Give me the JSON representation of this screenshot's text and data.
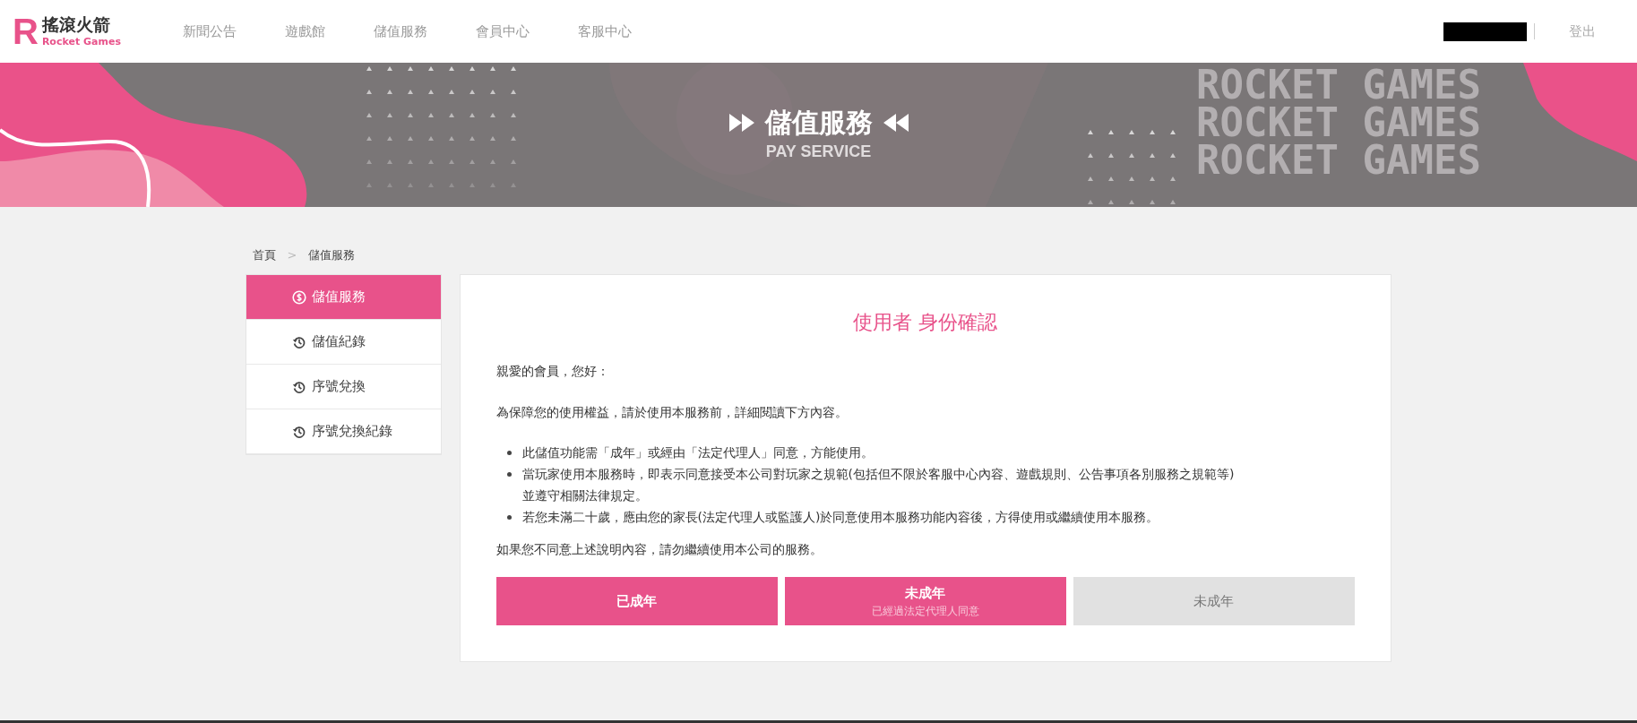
{
  "logo": {
    "mark": "R",
    "title": "搖滾火箭",
    "subtitle": "Rocket Games"
  },
  "nav": [
    {
      "label": "新聞公告",
      "selected": false
    },
    {
      "label": "遊戲館",
      "selected": false
    },
    {
      "label": "儲值服務",
      "selected": false
    },
    {
      "label": "會員中心",
      "selected": false
    },
    {
      "label": "客服中心",
      "selected": false
    }
  ],
  "logout": "登出",
  "banner": {
    "title": "儲值服務",
    "subtitle": "PAY SERVICE",
    "watermark": [
      "ROCKET GAMES",
      "ROCKET GAMES",
      "ROCKET GAMES"
    ]
  },
  "breadcrumb": [
    {
      "label": "首頁"
    },
    {
      "label": ">"
    },
    {
      "label": "儲值服務"
    }
  ],
  "sidebar": {
    "items": [
      {
        "label": "儲值服務",
        "kind": "dollar",
        "selected": true
      },
      {
        "label": "儲值紀錄",
        "kind": "history",
        "selected": false
      },
      {
        "label": "序號兌換",
        "kind": "history",
        "selected": false
      },
      {
        "label": "序號兌換紀錄",
        "kind": "history",
        "selected": false
      }
    ]
  },
  "card": {
    "title": "使用者 身份確認",
    "greeting": "親愛的會員，您好：",
    "intro": "為保障您的使用權益，請於使用本服務前，詳細閱讀下方內容。",
    "bullets": [
      "此儲值功能需「成年」或經由「法定代理人」同意，方能使用。",
      "當玩家使用本服務時，即表示同意接受本公司對玩家之規範(包括但不限於客服中心內容、遊戲規則、公告事項各別服務之規範等)並遵守相關法律規定。",
      "若您未滿二十歲，應由您的家長(法定代理人或監護人)於同意使用本服務功能內容後，方得使用或繼續使用本服務。"
    ],
    "footer": "如果您不同意上述說明內容，請勿繼續使用本公司的服務。",
    "buttons": [
      {
        "label": "已成年",
        "disabled": false
      },
      {
        "label": "未成年",
        "sublabel": "已經過法定代理人同意",
        "disabled": false
      },
      {
        "label": "未成年",
        "disabled": true
      }
    ]
  }
}
